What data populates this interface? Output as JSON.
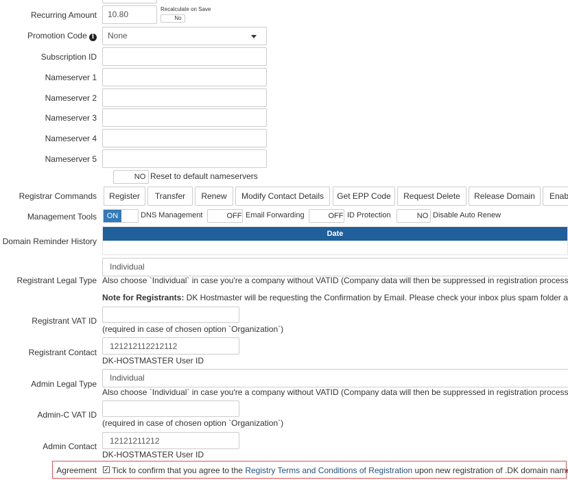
{
  "recurring_amount": {
    "label": "Recurring Amount",
    "value": "10.80",
    "recalc_label": "Recalculate on Save",
    "recalc_state": "No"
  },
  "promotion_code": {
    "label": "Promotion Code",
    "value": "None"
  },
  "subscription_id": {
    "label": "Subscription ID",
    "value": ""
  },
  "nameservers": [
    {
      "label": "Nameserver 1",
      "value": ""
    },
    {
      "label": "Nameserver 2",
      "value": ""
    },
    {
      "label": "Nameserver 3",
      "value": ""
    },
    {
      "label": "Nameserver 4",
      "value": ""
    },
    {
      "label": "Nameserver 5",
      "value": ""
    }
  ],
  "reset_nameservers": {
    "state": "NO",
    "label": "Reset to default nameservers"
  },
  "registrar_commands": {
    "label": "Registrar Commands",
    "buttons": [
      "Register",
      "Transfer",
      "Renew",
      "Modify Contact Details",
      "Get EPP Code",
      "Request Delete",
      "Release Domain",
      "Enab"
    ]
  },
  "management_tools": {
    "label": "Management Tools",
    "items": [
      {
        "state": "ON",
        "label": "DNS Management"
      },
      {
        "state": "OFF",
        "label": "Email Forwarding"
      },
      {
        "state": "OFF",
        "label": "ID Protection"
      },
      {
        "state": "NO",
        "label": "Disable Auto Renew"
      }
    ]
  },
  "domain_reminder_history": {
    "label": "Domain Reminder History",
    "column_header": "Date"
  },
  "registrant_legal_type": {
    "label": "Registrant Legal Type",
    "value": "Individual",
    "help": "Also choose `Individual` in case you're a company without VATID (Company data will then be suppressed in registration process).",
    "note_bold": "Note for Registrants:",
    "note_text": " DK Hostmaster will be requesting the Confirmation by Email. Please check your inbox plus spam folder and c"
  },
  "registrant_vat_id": {
    "label": "Registrant VAT ID",
    "value": "",
    "help": "(required in case of chosen option `Organization`)"
  },
  "registrant_contact": {
    "label": "Registrant Contact",
    "value": "121212112212112",
    "help": "DK-HOSTMASTER User ID"
  },
  "admin_legal_type": {
    "label": "Admin Legal Type",
    "value": "Individual",
    "help": "Also choose `Individual` in case you're a company without VATID (Company data will then be suppressed in registration process)."
  },
  "admin_vat_id": {
    "label": "Admin-C VAT ID",
    "value": "",
    "help": "(required in case of chosen option `Organization`)"
  },
  "admin_contact": {
    "label": "Admin Contact",
    "value": "12121211212",
    "help": "DK-HOSTMASTER User ID"
  },
  "agreement": {
    "label": "Agreement",
    "text_before": "Tick to confirm that you agree to the ",
    "link_text": "Registry Terms and Conditions of Registration",
    "text_after": " upon new registration of .DK domain names",
    "checked": true
  },
  "colors": {
    "accent": "#337ab7",
    "header_bg": "#1f5f9a",
    "highlight_border": "#d9534f",
    "link": "#23527c"
  }
}
